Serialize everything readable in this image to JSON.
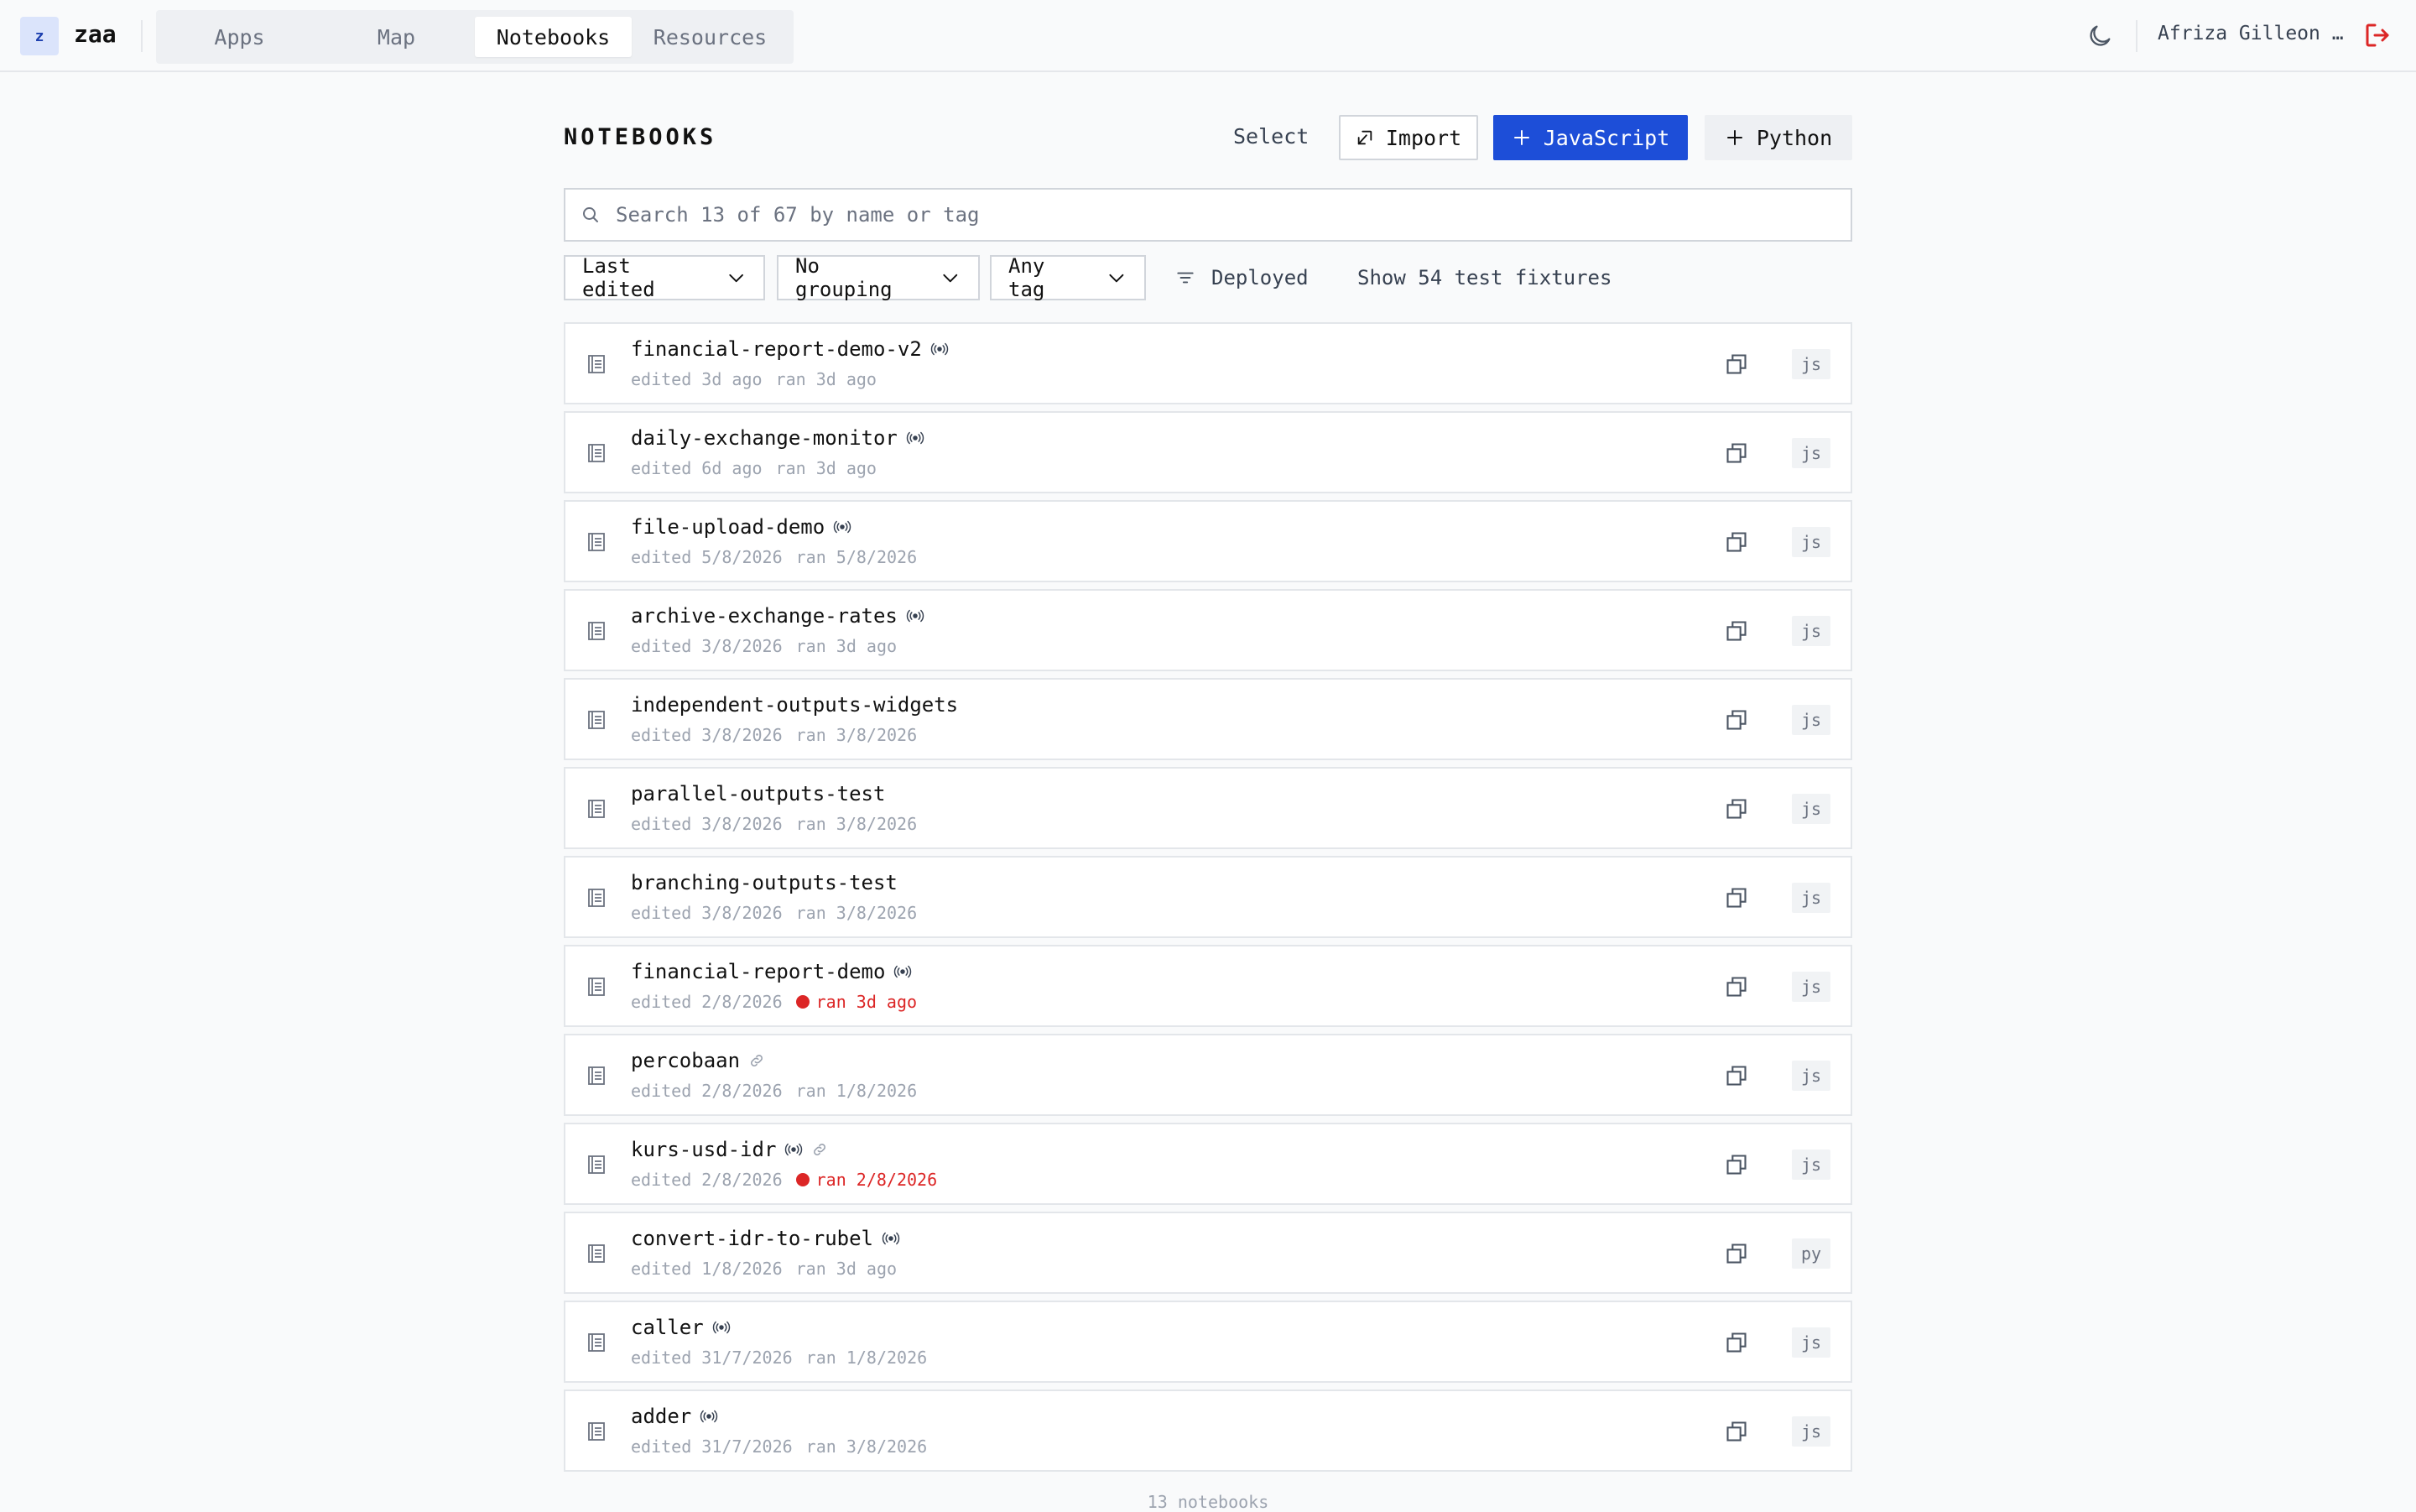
{
  "app": {
    "logo_letter": "z",
    "name": "zaa"
  },
  "nav": {
    "tabs": [
      {
        "label": "Apps"
      },
      {
        "label": "Map"
      },
      {
        "label": "Notebooks"
      },
      {
        "label": "Resources"
      }
    ],
    "active": "Notebooks"
  },
  "user": {
    "name": "Afriza Gilleon …"
  },
  "header": {
    "title": "NOTEBOOKS",
    "select_label": "Select",
    "import_label": "Import",
    "js_label": "JavaScript",
    "py_label": "Python"
  },
  "search": {
    "placeholder": "Search 13 of 67 by name or tag"
  },
  "filters": {
    "sort": "Last edited",
    "grouping": "No grouping",
    "tag": "Any tag",
    "deployed": "Deployed",
    "fixtures": "Show 54 test fixtures"
  },
  "notebooks": [
    {
      "name": "financial-report-demo-v2",
      "deployed": true,
      "linked": false,
      "edited": "edited 3d ago",
      "ran": "ran 3d ago",
      "ran_error": false,
      "lang": "js"
    },
    {
      "name": "daily-exchange-monitor",
      "deployed": true,
      "linked": false,
      "edited": "edited 6d ago",
      "ran": "ran 3d ago",
      "ran_error": false,
      "lang": "js"
    },
    {
      "name": "file-upload-demo",
      "deployed": true,
      "linked": false,
      "edited": "edited 5/8/2026",
      "ran": "ran 5/8/2026",
      "ran_error": false,
      "lang": "js"
    },
    {
      "name": "archive-exchange-rates",
      "deployed": true,
      "linked": false,
      "edited": "edited 3/8/2026",
      "ran": "ran 3d ago",
      "ran_error": false,
      "lang": "js"
    },
    {
      "name": "independent-outputs-widgets",
      "deployed": false,
      "linked": false,
      "edited": "edited 3/8/2026",
      "ran": "ran 3/8/2026",
      "ran_error": false,
      "lang": "js"
    },
    {
      "name": "parallel-outputs-test",
      "deployed": false,
      "linked": false,
      "edited": "edited 3/8/2026",
      "ran": "ran 3/8/2026",
      "ran_error": false,
      "lang": "js"
    },
    {
      "name": "branching-outputs-test",
      "deployed": false,
      "linked": false,
      "edited": "edited 3/8/2026",
      "ran": "ran 3/8/2026",
      "ran_error": false,
      "lang": "js"
    },
    {
      "name": "financial-report-demo",
      "deployed": true,
      "linked": false,
      "edited": "edited 2/8/2026",
      "ran": "ran 3d ago",
      "ran_error": true,
      "lang": "js"
    },
    {
      "name": "percobaan",
      "deployed": false,
      "linked": true,
      "edited": "edited 2/8/2026",
      "ran": "ran 1/8/2026",
      "ran_error": false,
      "lang": "js"
    },
    {
      "name": "kurs-usd-idr",
      "deployed": true,
      "linked": true,
      "edited": "edited 2/8/2026",
      "ran": "ran 2/8/2026",
      "ran_error": true,
      "lang": "js"
    },
    {
      "name": "convert-idr-to-rubel",
      "deployed": true,
      "linked": false,
      "edited": "edited 1/8/2026",
      "ran": "ran 3d ago",
      "ran_error": false,
      "lang": "py"
    },
    {
      "name": "caller",
      "deployed": true,
      "linked": false,
      "edited": "edited 31/7/2026",
      "ran": "ran 1/8/2026",
      "ran_error": false,
      "lang": "js"
    },
    {
      "name": "adder",
      "deployed": true,
      "linked": false,
      "edited": "edited 31/7/2026",
      "ran": "ran 3/8/2026",
      "ran_error": false,
      "lang": "js"
    }
  ],
  "footer": {
    "count": "13 notebooks"
  },
  "colors": {
    "accent": "#1d4ed8",
    "error": "#dc2626",
    "logout": "#dc2626"
  }
}
